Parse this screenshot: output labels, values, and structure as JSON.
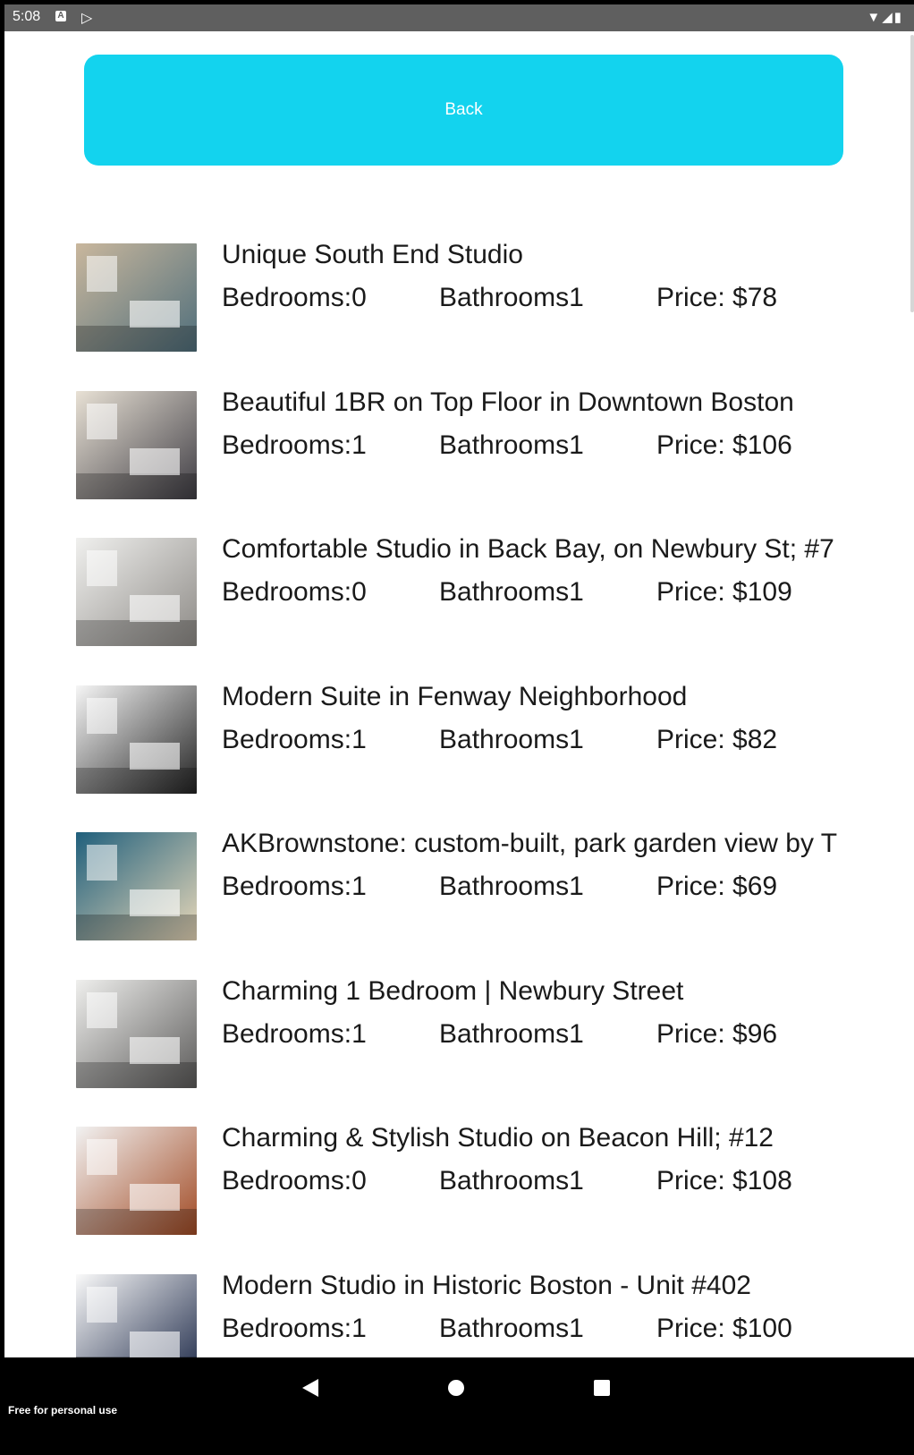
{
  "status_bar": {
    "time": "5:08",
    "notification_icon": "text-a-icon",
    "play_icon": "play-store-icon",
    "right_icons": [
      "wifi-icon",
      "signal-icon",
      "battery-icon"
    ],
    "background": "#5f5f5f"
  },
  "header": {
    "back_label": "Back",
    "back_color": "#13d3ee"
  },
  "listings": [
    {
      "title": "Unique South End Studio",
      "bedrooms": "Bedrooms:0",
      "bathrooms": "Bathrooms1",
      "price": "Price: $78",
      "image": "studio-room-photo"
    },
    {
      "title": "Beautiful 1BR on Top Floor in Downtown Boston",
      "bedrooms": "Bedrooms:1",
      "bathrooms": "Bathrooms1",
      "price": "Price: $106",
      "image": "living-room-photo"
    },
    {
      "title": "Comfortable Studio in Back Bay, on Newbury St; #7",
      "bedrooms": "Bedrooms:0",
      "bathrooms": "Bathrooms1",
      "price": "Price: $109",
      "image": "bedroom-photo"
    },
    {
      "title": "Modern Suite in Fenway Neighborhood",
      "bedrooms": "Bedrooms:1",
      "bathrooms": "Bathrooms1",
      "price": "Price: $82",
      "image": "suite-photo"
    },
    {
      "title": "AKBrownstone: custom-built, park garden view by T",
      "bedrooms": "Bedrooms:1",
      "bathrooms": "Bathrooms1",
      "price": "Price: $69",
      "image": "brownstone-photo"
    },
    {
      "title": "Charming 1 Bedroom | Newbury Street",
      "bedrooms": "Bedrooms:1",
      "bathrooms": "Bathrooms1",
      "price": "Price: $96",
      "image": "dining-room-photo"
    },
    {
      "title": "Charming & Stylish Studio on Beacon Hill; #12",
      "bedrooms": "Bedrooms:0",
      "bathrooms": "Bathrooms1",
      "price": "Price: $108",
      "image": "beacon-hill-studio-photo"
    },
    {
      "title": "Modern Studio in Historic Boston - Unit #402",
      "bedrooms": "Bedrooms:1",
      "bathrooms": "Bathrooms1",
      "price": "Price: $100",
      "image": "historic-studio-photo"
    }
  ],
  "nav_bar": {
    "back_icon": "nav-back-icon",
    "home_icon": "nav-home-icon",
    "recents_icon": "nav-recents-icon",
    "watermark": "Free for personal use"
  }
}
